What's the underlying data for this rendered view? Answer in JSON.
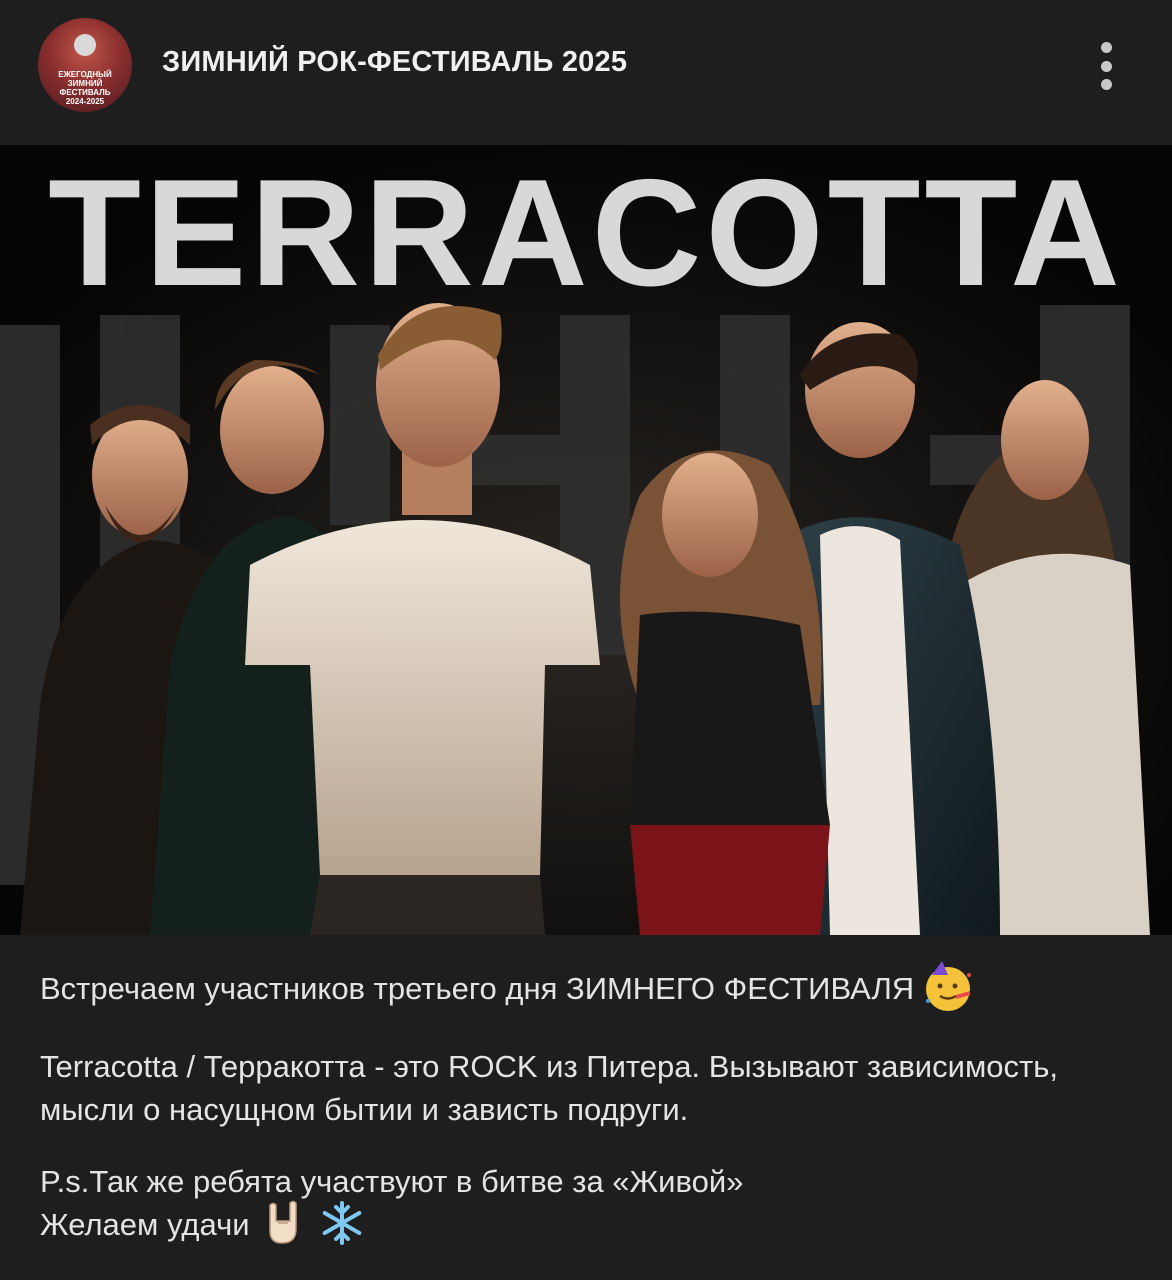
{
  "channel": {
    "title": "ЗИМНИЙ РОК-ФЕСТИВАЛЬ 2025",
    "avatar_text": "ЕЖЕГОДНЫЙ\nЗИМНИЙ\nФЕСТИВАЛЬ\n2024-2025",
    "menu_icon": "more-vertical-icon"
  },
  "poster": {
    "band_name": "TERRACOTTA"
  },
  "post": {
    "line1": "Встречаем участников третьего дня ЗИМНЕГО ФЕСТИВАЛЯ",
    "line1_emoji": "partying-face-emoji",
    "paragraph2": "Terracotta / Терракотта - это ROCK из Питера. Вызывают зависимость, мысли о насущном бытии и зависть подруги.",
    "line3": "P.s.Так же ребята участвуют в битве за «Живой»",
    "line4": "Желаем удачи",
    "line4_emojis": [
      "rock-hand-emoji",
      "snowflake-emoji"
    ]
  },
  "colors": {
    "background": "#1e1e1e",
    "text": "#e4e4e4",
    "poster_title": "#d8d8d8"
  }
}
